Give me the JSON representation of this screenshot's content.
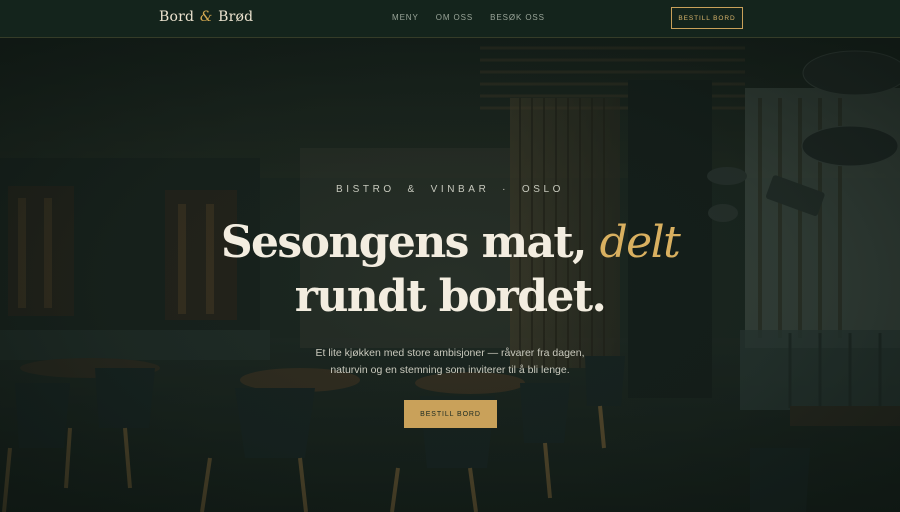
{
  "nav": {
    "logo_left": "Bord",
    "logo_amp": "&",
    "logo_right": "Brød",
    "links": [
      {
        "label": "MENY"
      },
      {
        "label": "OM OSS"
      },
      {
        "label": "BESØK OSS"
      }
    ],
    "cta_label": "BESTILL BORD"
  },
  "hero": {
    "eyebrow": "BISTRO  &  VINBAR  ·  OSLO",
    "headline_line1": "Sesongens mat,",
    "headline_accent": "delt",
    "headline_line2": "rundt bordet.",
    "subtitle_line1": "Et lite kjøkken med store ambisjoner — råvarer fra dagen,",
    "subtitle_line2": "naturvin og en stemning som inviterer til å bli lenge.",
    "cta_label": "BESTILL BORD"
  },
  "colors": {
    "nav_background": "#14241c",
    "accent_gold": "#c9a15a",
    "headline_text": "#f3ede0",
    "accent_text": "#d9b060"
  }
}
